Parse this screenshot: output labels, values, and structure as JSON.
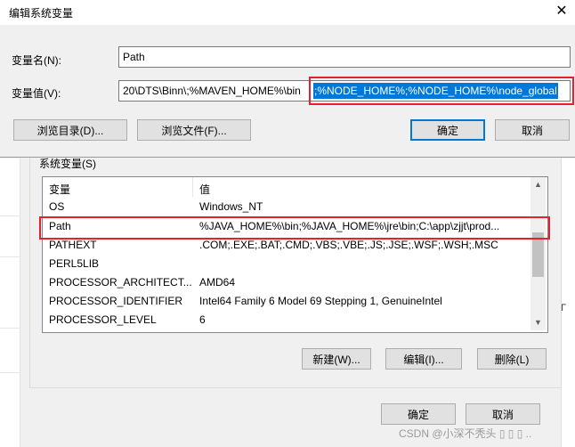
{
  "edit_dialog": {
    "title": "编辑系统变量",
    "name_label": "变量名(N):",
    "name_value": "Path",
    "value_label": "变量值(V):",
    "value_prefix": "20\\DTS\\Binn\\;%MAVEN_HOME%\\bin",
    "value_selected": ";%NODE_HOME%;%NODE_HOME%\\node_global",
    "browse_dir_button": "浏览目录(D)...",
    "browse_file_button": "浏览文件(F)...",
    "ok_button": "确定",
    "cancel_button": "取消"
  },
  "parent_dialog": {
    "group_label": "系统变量(S)",
    "columns": [
      "变量",
      "值"
    ],
    "rows": [
      {
        "name": "OS",
        "value": "Windows_NT"
      },
      {
        "name": "Path",
        "value": "%JAVA_HOME%\\bin;%JAVA_HOME%\\jre\\bin;C:\\app\\zjjt\\prod..."
      },
      {
        "name": "PATHEXT",
        "value": ".COM;.EXE;.BAT;.CMD;.VBS;.VBE;.JS;.JSE;.WSF;.WSH;.MSC"
      },
      {
        "name": "PERL5LIB",
        "value": ""
      },
      {
        "name": "PROCESSOR_ARCHITECT...",
        "value": "AMD64"
      },
      {
        "name": "PROCESSOR_IDENTIFIER",
        "value": "Intel64 Family 6 Model 69 Stepping 1, GenuineIntel"
      },
      {
        "name": "PROCESSOR_LEVEL",
        "value": "6"
      }
    ],
    "new_button": "新建(W)...",
    "edit_button": "编辑(I)...",
    "delete_button": "删除(L)",
    "ok_button": "确定",
    "cancel_button": "取消",
    "right_edge_text": "Г"
  },
  "watermark": "CSDN @小深不秃头 ▯ ▯ ▯ ..",
  "colors": {
    "highlight": "#0078d7",
    "annotation_red": "#e8202a"
  }
}
